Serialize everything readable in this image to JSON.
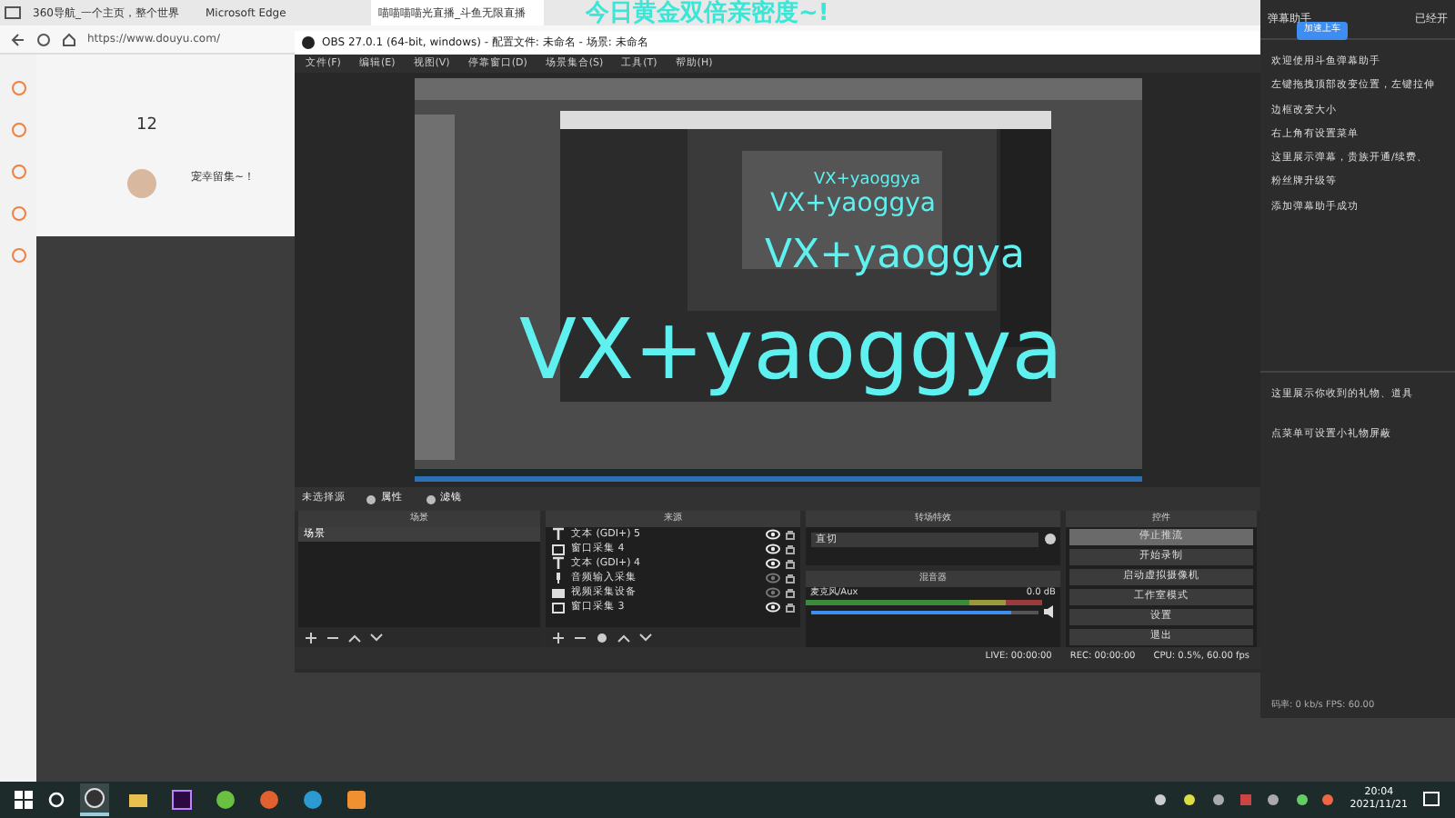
{
  "browser": {
    "tabs": [
      {
        "label": "360导航_一个主页，整个世界",
        "selected": false
      },
      {
        "label": "Microsoft Edge",
        "selected": false
      },
      {
        "label": "喵喵喵喵光直播_斗鱼无限直播",
        "selected": true
      }
    ],
    "url": "https://www.douyu.com/",
    "page": {
      "count": "12",
      "user": "宠幸留集~！"
    }
  },
  "overlay_text": "今日黄金双倍亲密度~!",
  "obs": {
    "title": "OBS 27.0.1 (64-bit, windows) - 配置文件: 未命名 - 场景: 未命名",
    "menu": [
      "文件(F)",
      "编辑(E)",
      "视图(V)",
      "停靠窗口(D)",
      "场景集合(S)",
      "工具(T)",
      "帮助(H)"
    ],
    "preview_texts": [
      "VX+yaoggya",
      "VX+yaoggya",
      "VX+yaoggya",
      "VX+yaoggya"
    ],
    "source_toolbar": {
      "label": "未选择源",
      "buttons": [
        "属性",
        "滤镜"
      ]
    },
    "scenes": {
      "title": "场景",
      "items": [
        {
          "label": "场景",
          "selected": true
        }
      ]
    },
    "sources": {
      "title": "来源",
      "items": [
        {
          "kind": "text",
          "label": "文本 (GDI+) 5",
          "visible": true
        },
        {
          "kind": "window",
          "label": "窗口采集 4",
          "visible": true
        },
        {
          "kind": "text",
          "label": "文本 (GDI+) 4",
          "visible": true
        },
        {
          "kind": "audio",
          "label": "音频输入采集",
          "visible": false
        },
        {
          "kind": "video",
          "label": "视频采集设备",
          "visible": false
        },
        {
          "kind": "window",
          "label": "窗口采集 3",
          "visible": true
        }
      ]
    },
    "transitions": {
      "title": "转场特效",
      "value": "直切"
    },
    "mixer": {
      "title": "混音器",
      "channel": "麦克风/Aux",
      "reading": "0.0 dB",
      "level": 0.88
    },
    "controls": {
      "title": "控件",
      "buttons": [
        {
          "label": "停止推流",
          "active": true
        },
        {
          "label": "开始录制",
          "active": false
        },
        {
          "label": "启动虚拟摄像机",
          "active": false
        },
        {
          "label": "工作室模式",
          "active": false
        },
        {
          "label": "设置",
          "active": false
        },
        {
          "label": "退出",
          "active": false
        }
      ]
    },
    "status": [
      "LIVE: 00:00:00",
      "REC: 00:00:00",
      "CPU: 0.5%, 60.00 fps"
    ]
  },
  "danmu": {
    "title": "弹幕助手",
    "button": "加速上车",
    "badge": "已经开",
    "messages": [
      "欢迎使用斗鱼弹幕助手",
      "左键拖拽顶部改变位置，左键拉伸",
      "边框改变大小",
      "右上角有设置菜单",
      "这里展示弹幕，贵族开通/续费、",
      "粉丝牌升级等",
      "添加弹幕助手成功"
    ],
    "gift_messages": [
      "这里展示你收到的礼物、道具",
      "点菜单可设置小礼物屏蔽"
    ],
    "footer": "码率: 0 kb/s  FPS: 60.00"
  },
  "taskbar": {
    "apps": [
      {
        "kind": "obs",
        "active": true
      },
      {
        "kind": "folder",
        "active": false
      },
      {
        "kind": "premiere",
        "active": false
      },
      {
        "kind": "browser360",
        "active": false
      },
      {
        "kind": "fire",
        "active": false
      },
      {
        "kind": "edge",
        "active": false
      },
      {
        "kind": "app",
        "active": false
      }
    ],
    "time": "20:04",
    "date": "2021/11/21"
  }
}
